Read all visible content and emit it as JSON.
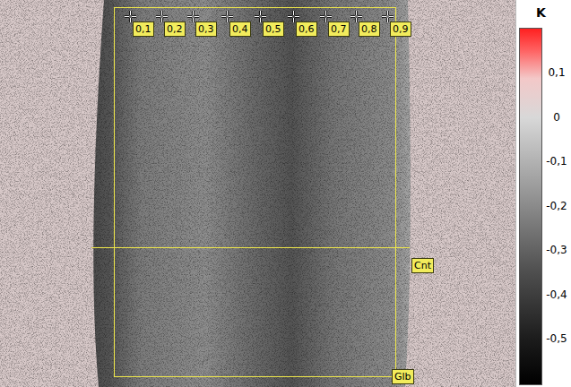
{
  "thermogram": {
    "kind": "photo"
  },
  "points": [
    {
      "label": "0,1"
    },
    {
      "label": "0,2"
    },
    {
      "label": "0,3"
    },
    {
      "label": "0,4"
    },
    {
      "label": "0,5"
    },
    {
      "label": "0,6"
    },
    {
      "label": "0,7"
    },
    {
      "label": "0,8"
    },
    {
      "label": "0,9"
    }
  ],
  "line": {
    "label": "Cnt"
  },
  "area": {
    "label": "Glb"
  },
  "scale": {
    "unit": "K",
    "ticks": [
      "0,1",
      "0",
      "-0,1",
      "-0,2",
      "-0,3",
      "-0,4",
      "-0,5"
    ]
  }
}
